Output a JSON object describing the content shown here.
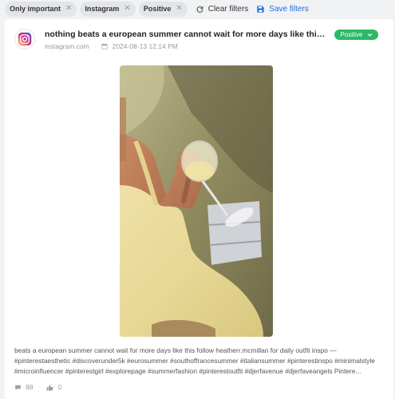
{
  "filters": {
    "chips": [
      {
        "label": "Only important"
      },
      {
        "label": "Instagram"
      },
      {
        "label": "Positive"
      }
    ],
    "clear_label": "Clear filters",
    "save_label": "Save filters"
  },
  "post": {
    "title": "nothing beats a european summer  cannot wait for more days like this foll...",
    "source": "instagram.com",
    "date": "2024-08-13 12:14 PM",
    "sentiment": "Positive",
    "description": "beats a european summer  cannot wait for more days like this follow heatherr.mcmillan for daily outfit inspo — #pinterestaesthetic #discoverunder5k #eurosummer #southoffrancesummer #italiansummer #pinterestinspo #minimalstyle #microinfluencer #pinterestgirl #explorepage #summerfashion #pinterestoutfit #djerfavenue #djerfaveangels Pintere...",
    "comments": "88",
    "likes": "0"
  },
  "colors": {
    "accent": "#1e6fd9",
    "positive": "#2cb866",
    "instagram_gradient": [
      "#feda75",
      "#d62976",
      "#4f5bd5"
    ]
  }
}
